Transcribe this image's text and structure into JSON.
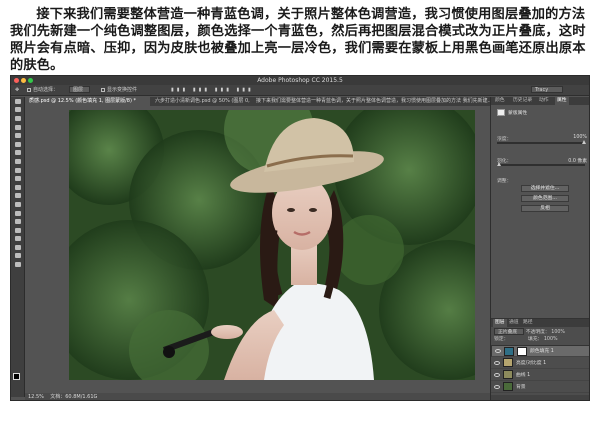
{
  "article": {
    "paragraph": "接下来我们需要整体营造一种青蓝色调，关于照片整体色调营造，我习惯使用图层叠加的方法我们先新建一个纯色调整图层，颜色选择一个青蓝色，然后再把图层混合模式改为正片叠底，这时照片会有点暗、压抑，因为皮肤也被叠加上亮一层冷色，我们需要在蒙板上用黑色画笔还原出原本的肤色。"
  },
  "app": {
    "title": "Adobe Photoshop CC 2015.5",
    "workspace": "Tracy"
  },
  "options_bar": {
    "auto_select": "自动选择：",
    "auto_select_value": "图层",
    "show_transform": "显示变换控件"
  },
  "tabs": [
    {
      "label": "质感.psd @ 12.5% (颜色填充 1, 图层蒙版/8) *"
    },
    {
      "label": "六步打造小清新调色.psd @ 50% (图层 0, RGB/8#)"
    },
    {
      "label": "接下来我们需要整体营造一种青蓝色调，关于照片整体色调营造，我习惯使用图层叠加的方法 我们先新建..."
    }
  ],
  "status_bar": {
    "zoom": "12.5%",
    "doc": "文档：60.8M/1.61G"
  },
  "panel_tabs": [
    "颜色",
    "历史记录",
    "动作",
    "属性"
  ],
  "properties": {
    "title": "蒙版属性",
    "density_label": "浓度：",
    "density_value": "100%",
    "feather_label": "羽化：",
    "feather_value": "0.0 像素",
    "refine_label": "调整：",
    "select_mask_button": "选择并遮住...",
    "color_range_button": "颜色范围...",
    "invert_button": "反相"
  },
  "layers_panel": {
    "tabs": [
      "图层",
      "通道",
      "路径"
    ],
    "blend_mode": "正片叠底",
    "opacity_label": "不透明度：",
    "opacity_value": "100%",
    "fill_label": "填充：",
    "fill_value": "100%",
    "lock_label": "锁定：",
    "layers": [
      {
        "name": "颜色填充 1",
        "selected": true
      },
      {
        "name": "亮度/对比度 1",
        "selected": false
      },
      {
        "name": "曲线 1",
        "selected": false
      },
      {
        "name": "背景",
        "selected": false
      }
    ]
  },
  "colors": {
    "teal_fill": "#2f6f86",
    "ui_dark": "#3a3a3a",
    "ui_mid": "#535353"
  }
}
